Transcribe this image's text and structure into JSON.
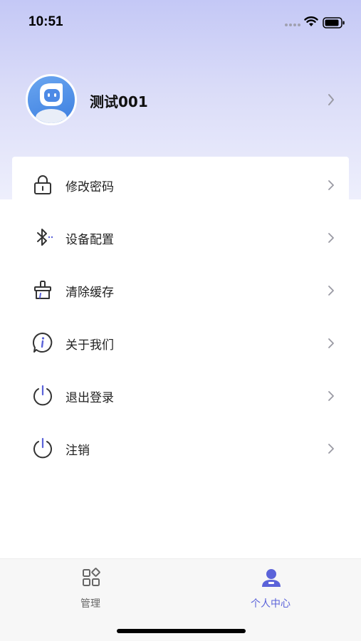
{
  "status_bar": {
    "time": "10:51"
  },
  "profile": {
    "name": "测试001",
    "avatar_icon": "robot-avatar-icon"
  },
  "menu": {
    "items": [
      {
        "label": "修改密码",
        "icon": "lock-icon"
      },
      {
        "label": "设备配置",
        "icon": "bluetooth-icon"
      },
      {
        "label": "清除缓存",
        "icon": "broom-icon"
      },
      {
        "label": "关于我们",
        "icon": "info-icon"
      },
      {
        "label": "退出登录",
        "icon": "power-icon"
      },
      {
        "label": "注销",
        "icon": "power-icon"
      }
    ]
  },
  "tabbar": {
    "tabs": [
      {
        "label": "管理",
        "icon": "grid-icon",
        "active": false
      },
      {
        "label": "个人中心",
        "icon": "person-icon",
        "active": true
      }
    ]
  },
  "colors": {
    "accent": "#5b63d9",
    "inactive": "#666666",
    "hero_top": "#c4c8f6"
  }
}
